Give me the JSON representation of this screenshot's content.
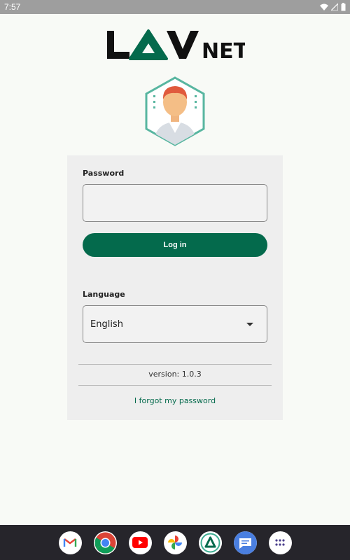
{
  "status_bar": {
    "time": "7:57"
  },
  "logo": {
    "text_left": "L",
    "text_right": "V",
    "text_small": "NET"
  },
  "login": {
    "password_label": "Password",
    "password_value": "",
    "login_button": "Log in",
    "language_label": "Language",
    "language_value": "English",
    "version": "version: 1.0.3",
    "forgot_link": "I forgot my password"
  },
  "dock": {
    "apps": [
      "gmail-icon",
      "chrome-icon",
      "youtube-icon",
      "photos-icon",
      "lavnet-app-icon",
      "messages-icon",
      "app-drawer-icon"
    ]
  },
  "colors": {
    "accent": "#046a4c",
    "teal": "#3fae93",
    "background": "#f8faf6",
    "card": "#eeeeee"
  }
}
